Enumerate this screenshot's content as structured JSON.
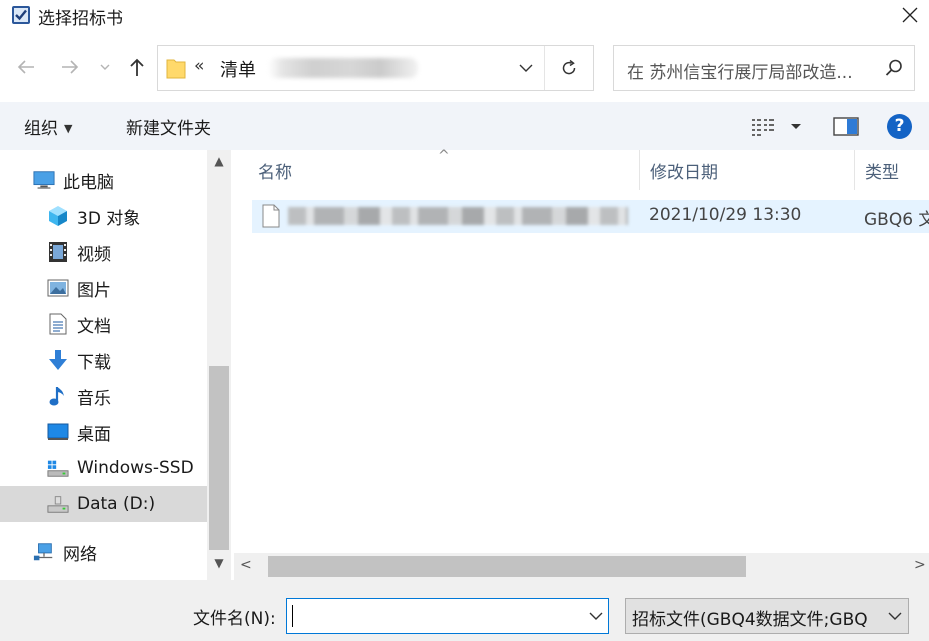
{
  "window": {
    "title": "选择招标书"
  },
  "address": {
    "chevron": "«",
    "path_label": "清单",
    "search_placeholder": "在 苏州信宝行展厅局部改造..."
  },
  "toolbar": {
    "organize_label": "组织",
    "new_folder_label": "新建文件夹"
  },
  "nav": {
    "items": [
      {
        "label": "此电脑",
        "icon": "pc-icon"
      },
      {
        "label": "3D 对象",
        "icon": "3d-objects-icon"
      },
      {
        "label": "视频",
        "icon": "video-icon"
      },
      {
        "label": "图片",
        "icon": "pictures-icon"
      },
      {
        "label": "文档",
        "icon": "documents-icon"
      },
      {
        "label": "下载",
        "icon": "download-icon"
      },
      {
        "label": "音乐",
        "icon": "music-icon"
      },
      {
        "label": "桌面",
        "icon": "desktop-icon"
      },
      {
        "label": "Windows-SSD",
        "icon": "drive-c-icon"
      },
      {
        "label": "Data (D:)",
        "icon": "drive-d-icon"
      },
      {
        "label": "网络",
        "icon": "network-icon"
      }
    ],
    "selected_index": 9
  },
  "columns": {
    "name": "名称",
    "date": "修改日期",
    "type": "类型"
  },
  "files": [
    {
      "date": "2021/10/29 13:30",
      "type": "GBQ6 文"
    }
  ],
  "bottom": {
    "filename_label": "文件名(N):",
    "filename_value": "",
    "filter_label": "招标文件(GBQ4数据文件;GBQ"
  }
}
